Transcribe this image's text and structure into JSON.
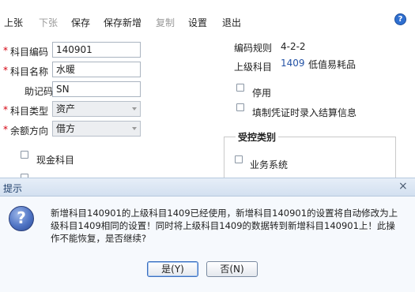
{
  "toolbar": {
    "items": [
      "上张",
      "下张",
      "保存",
      "保存新增",
      "复制",
      "设置",
      "退出"
    ],
    "help_glyph": "?"
  },
  "form": {
    "required_mark": "*",
    "code_label": "科目编码",
    "code_value": "140901",
    "name_label": "科目名称",
    "name_value": "水暖",
    "mnemonic_label": "助记码",
    "mnemonic_value": "SN",
    "type_label": "科目类型",
    "type_value": "资产",
    "direction_label": "余额方向",
    "direction_value": "借方",
    "cash_label": "现金科目",
    "code_rule_label": "编码规则",
    "code_rule_value": "4-2-2",
    "parent_label": "上级科目",
    "parent_code": "1409",
    "parent_name": "低值易耗品",
    "disable_label": "停用",
    "settlement_label": "填制凭证时录入结算信息",
    "controlled_title": "受控类别",
    "business_label": "业务系统"
  },
  "dialog": {
    "title": "提示",
    "close_glyph": "×",
    "icon_glyph": "?",
    "message": "新增科目140901的上级科目1409已经使用，新增科目140901的设置将自动修改为上级科目1409相同的设置！同时将上级科目1409的数据转到新增科目140901上！此操作不能恢复，是否继续?",
    "yes_label": "是(Y)",
    "no_label": "否(N)"
  }
}
